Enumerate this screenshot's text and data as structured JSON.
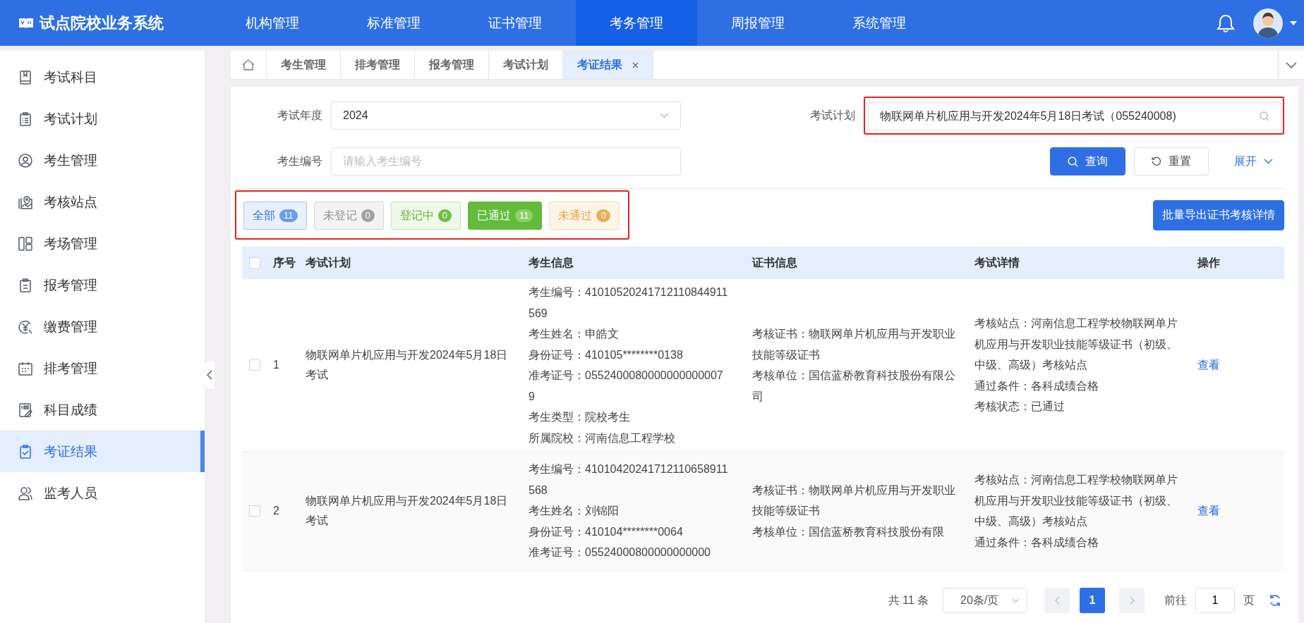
{
  "app": {
    "title": "试点院校业务系统"
  },
  "nav": [
    {
      "label": "机构管理",
      "selected": false
    },
    {
      "label": "标准管理",
      "selected": false
    },
    {
      "label": "证书管理",
      "selected": false
    },
    {
      "label": "考务管理",
      "selected": true
    },
    {
      "label": "周报管理",
      "selected": false
    },
    {
      "label": "系统管理",
      "selected": false
    }
  ],
  "sidebar": {
    "items": [
      {
        "label": "考试科目",
        "selected": false
      },
      {
        "label": "考试计划",
        "selected": false
      },
      {
        "label": "考生管理",
        "selected": false
      },
      {
        "label": "考核站点",
        "selected": false
      },
      {
        "label": "考场管理",
        "selected": false
      },
      {
        "label": "报考管理",
        "selected": false
      },
      {
        "label": "缴费管理",
        "selected": false
      },
      {
        "label": "排考管理",
        "selected": false
      },
      {
        "label": "科目成绩",
        "selected": false
      },
      {
        "label": "考证结果",
        "selected": true
      },
      {
        "label": "监考人员",
        "selected": false
      }
    ]
  },
  "tabs": [
    {
      "label": "考生管理",
      "selected": false
    },
    {
      "label": "排考管理",
      "selected": false
    },
    {
      "label": "报考管理",
      "selected": false
    },
    {
      "label": "考试计划",
      "selected": false
    },
    {
      "label": "考证结果",
      "selected": true
    }
  ],
  "filters": {
    "year": {
      "label": "考试年度",
      "value": "2024"
    },
    "plan": {
      "label": "考试计划",
      "value": "物联网单片机应用与开发2024年5月18日考试（055240008)"
    },
    "student_no": {
      "label": "考生编号",
      "placeholder": "请输入考生编号"
    },
    "search_button": "查询",
    "reset_button": "重置",
    "expand_link": "展开"
  },
  "status_filters": [
    {
      "kind": "all",
      "label": "全部",
      "count": "11",
      "selected": false
    },
    {
      "kind": "unregistered",
      "label": "未登记",
      "count": "0",
      "selected": false
    },
    {
      "kind": "registering",
      "label": "登记中",
      "count": "0",
      "selected": false
    },
    {
      "kind": "passed",
      "label": "已通过",
      "count": "11",
      "selected": true
    },
    {
      "kind": "failed",
      "label": "未通过",
      "count": "0",
      "selected": false
    }
  ],
  "export_button": "批量导出证书考核详情",
  "table": {
    "select_all_checked": false,
    "columns": [
      "序号",
      "考试计划",
      "考生信息",
      "证书信息",
      "考试详情",
      "操作"
    ],
    "rows": [
      {
        "checked": false,
        "seq": "1",
        "plan": "物联网单片机应用与开发2024年5月18日考试",
        "info": [
          "考生编号：41010520241712110844911569",
          "考生姓名：申皓文",
          "身份证号：410105********0138",
          "准考证号：05524000800000000000079",
          "考生类型：院校考生",
          "所属院校：河南信息工程学校"
        ],
        "cert": [
          "考核证书：物联网单片机应用与开发职业技能等级证书",
          "考核单位：国信蓝桥教育科技股份有限公司"
        ],
        "details": [
          "考核站点：河南信息工程学校物联网单片机应用与开发职业技能等级证书（初级、中级、高级）考核站点",
          "通过条件：各科成绩合格",
          "考核状态：已通过"
        ],
        "action": "查看"
      },
      {
        "checked": false,
        "seq": "2",
        "plan": "物联网单片机应用与开发2024年5月18日考试",
        "info": [
          "考生编号：41010420241712110658911568",
          "考生姓名：刘锦阳",
          "身份证号：410104********0064",
          "准考证号：05524000800000000000"
        ],
        "cert": [
          "考核证书：物联网单片机应用与开发职业技能等级证书",
          "考核单位：国信蓝桥教育科技股份有限"
        ],
        "details": [
          "考核站点：河南信息工程学校物联网单片机应用与开发职业技能等级证书（初级、中级、高级）考核站点",
          "通过条件：各科成绩合格"
        ],
        "action": "查看"
      }
    ]
  },
  "pagination": {
    "total": "共 11 条",
    "page_size": "20条/页",
    "pages": [
      {
        "label": "1",
        "selected": true
      }
    ],
    "goto_label": "前往",
    "goto_value": "1",
    "page_unit": "页"
  }
}
